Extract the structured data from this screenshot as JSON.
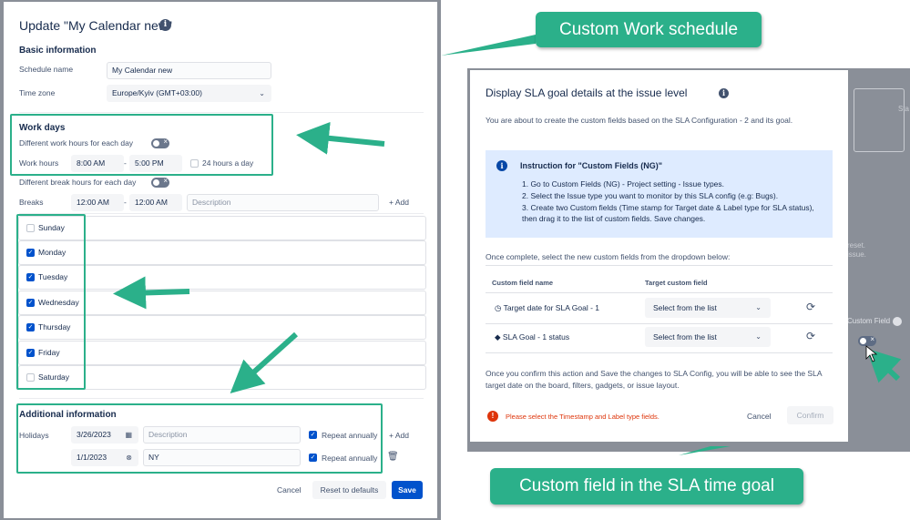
{
  "left_dialog": {
    "title": "Update \"My Calendar new\"",
    "basic_info_title": "Basic information",
    "schedule_name_label": "Schedule name",
    "schedule_name_value": "My Calendar new",
    "time_zone_label": "Time zone",
    "time_zone_value": "Europe/Kyiv (GMT+03:00)",
    "work_days_title": "Work days",
    "different_hours_label": "Different work hours for each day",
    "work_hours_label": "Work hours",
    "work_start": "8:00 AM",
    "work_dash": "-",
    "work_end": "5:00 PM",
    "hours_24_label": "24 hours a day",
    "different_break_label": "Different break hours for each day",
    "breaks_label": "Breaks",
    "break_start": "12:00 AM",
    "break_dash": "-",
    "break_end": "12:00 AM",
    "description_placeholder": "Description",
    "add_label": "Add",
    "days": [
      {
        "name": "Sunday",
        "checked": false
      },
      {
        "name": "Monday",
        "checked": true
      },
      {
        "name": "Tuesday",
        "checked": true
      },
      {
        "name": "Wednesday",
        "checked": true
      },
      {
        "name": "Thursday",
        "checked": true
      },
      {
        "name": "Friday",
        "checked": true
      },
      {
        "name": "Saturday",
        "checked": false
      }
    ],
    "additional_title": "Additional information",
    "holidays_label": "Holidays",
    "holiday1_date": "3/26/2023",
    "holiday1_desc_placeholder": "Description",
    "holiday2_date": "1/1/2023",
    "holiday2_desc": "NY",
    "repeat_annually_label": "Repeat annually",
    "cancel_label": "Cancel",
    "reset_label": "Reset to defaults",
    "save_label": "Save"
  },
  "callouts": {
    "top": "Custom Work schedule",
    "bottom": "Custom field in the SLA time goal"
  },
  "background": {
    "frag_sta": "Sta",
    "frag_reset": "reset.",
    "frag_issue": "issue.",
    "frag_custom_field": "Custom Field"
  },
  "right_modal": {
    "title": "Display SLA goal details at the issue level",
    "intro": "You are about to create the custom fields based on the SLA Configuration - 2 and its goal.",
    "panel_title": "Instruction for \"Custom Fields (NG)\"",
    "steps": [
      "1. Go to Custom Fields (NG) - Project setting - Issue types.",
      "2. Select the Issue type you want to monitor by this SLA config (e.g: Bugs).",
      "3. Create two Custom fields (Time stamp for Target date & Label type for SLA status), then drag it to the list of custom fields. Save changes."
    ],
    "once_complete": "Once complete, select the new custom fields from the dropdown below:",
    "col_custom_field": "Custom field name",
    "col_target": "Target custom field",
    "rows": [
      {
        "name": "Target date for SLA Goal - 1",
        "select": "Select from the list"
      },
      {
        "name": "SLA Goal - 1 status",
        "select": "Select from the list"
      }
    ],
    "confirm_text": "Once you confirm this action and Save the changes to SLA Config, you will be able to see the SLA target date on the board, filters, gadgets, or issue layout.",
    "error_text": "Please select the Timestamp and Label type fields.",
    "cancel_label": "Cancel",
    "confirm_label": "Confirm"
  },
  "colors": {
    "accent": "#2bb08a",
    "primary": "#0052cc",
    "error": "#de350b"
  }
}
